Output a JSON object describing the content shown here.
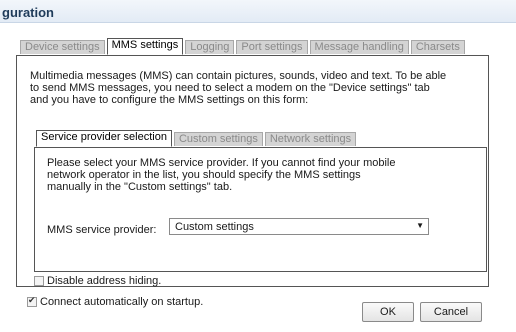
{
  "window": {
    "title": "guration"
  },
  "top_tabs": [
    {
      "label": "Device settings",
      "active": false
    },
    {
      "label": "MMS settings",
      "active": true
    },
    {
      "label": "Logging",
      "active": false
    },
    {
      "label": "Port settings",
      "active": false
    },
    {
      "label": "Message handling",
      "active": false
    },
    {
      "label": "Charsets",
      "active": false
    }
  ],
  "mms": {
    "intro": "Multimedia messages (MMS) can contain pictures, sounds, video and text. To be able to send MMS messages, you need to select a modem on the \"Device settings\" tab and you have to configure the MMS settings on this form:",
    "inner_tabs": [
      {
        "label": "Service provider selection",
        "active": true
      },
      {
        "label": "Custom settings",
        "active": false
      },
      {
        "label": "Network settings",
        "active": false
      }
    ],
    "info": "Please select your MMS service provider. If you cannot find your mobile network operator in the list, you should specify the MMS  settings manually in the \"Custom settings\" tab.",
    "provider_label": "MMS service provider:",
    "provider_value": "Custom settings",
    "disable_hiding_label": "Disable address hiding.",
    "disable_hiding_checked": false
  },
  "footer": {
    "connect_label": "Connect automatically on startup.",
    "connect_checked": true,
    "ok_label": "OK",
    "cancel_label": "Cancel"
  }
}
